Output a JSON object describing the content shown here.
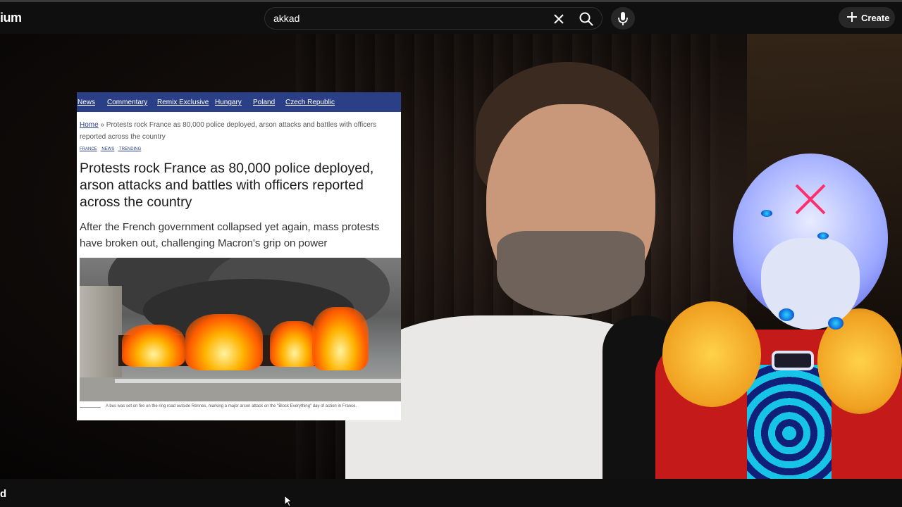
{
  "header": {
    "brand_text": "ium",
    "search": {
      "value": "akkad",
      "placeholder": "Search"
    },
    "icons": [
      "clear-icon",
      "search-icon",
      "microphone-icon",
      "plus-icon"
    ],
    "create_label": "Create"
  },
  "article": {
    "nav": [
      "News",
      "Commentary",
      "Remix Exclusive",
      "Hungary",
      "Poland",
      "Czech Republic"
    ],
    "breadcrumb_home": "Home",
    "breadcrumb_rest": " » Protests rock France as 80,000 police deployed, arson attacks and battles with officers reported across the country",
    "tags": [
      "FRANCE",
      "NEWS",
      "TRENDING"
    ],
    "headline": "Protests rock France as 80,000 police deployed, arson attacks and battles with officers reported across the country",
    "dek": "After the French government collapsed yet again, mass protests have broken out, challenging Macron's grip on power",
    "caption": "A bus was set on fire on the ring road outside Rennes, marking a major arson attack on the \"Block Everything\" day of action in France.",
    "brand_color": "#2b3f86"
  },
  "footer": {
    "text": "d"
  }
}
